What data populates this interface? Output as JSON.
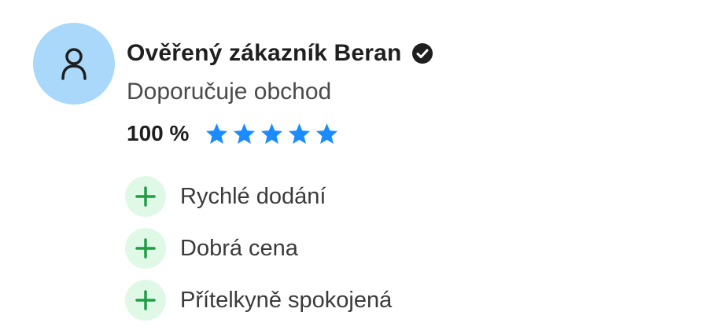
{
  "reviewer": {
    "name": "Ověřený zákazník Beran",
    "verified_icon": "check-circle-icon",
    "avatar_icon": "person-icon"
  },
  "recommendation": "Doporučuje obchod",
  "rating": {
    "percent_label": "100 %",
    "stars_filled": 5,
    "stars_total": 5,
    "star_color": "#1a8cff"
  },
  "pros": [
    {
      "label": "Rychlé dodání",
      "icon": "plus-icon"
    },
    {
      "label": "Dobrá cena",
      "icon": "plus-icon"
    },
    {
      "label": "Přítelkyně spokojená",
      "icon": "plus-icon"
    }
  ],
  "colors": {
    "avatar_bg": "#a9d8fa",
    "plus_bg": "#e0f9e6",
    "plus_fg": "#1e9e45"
  }
}
